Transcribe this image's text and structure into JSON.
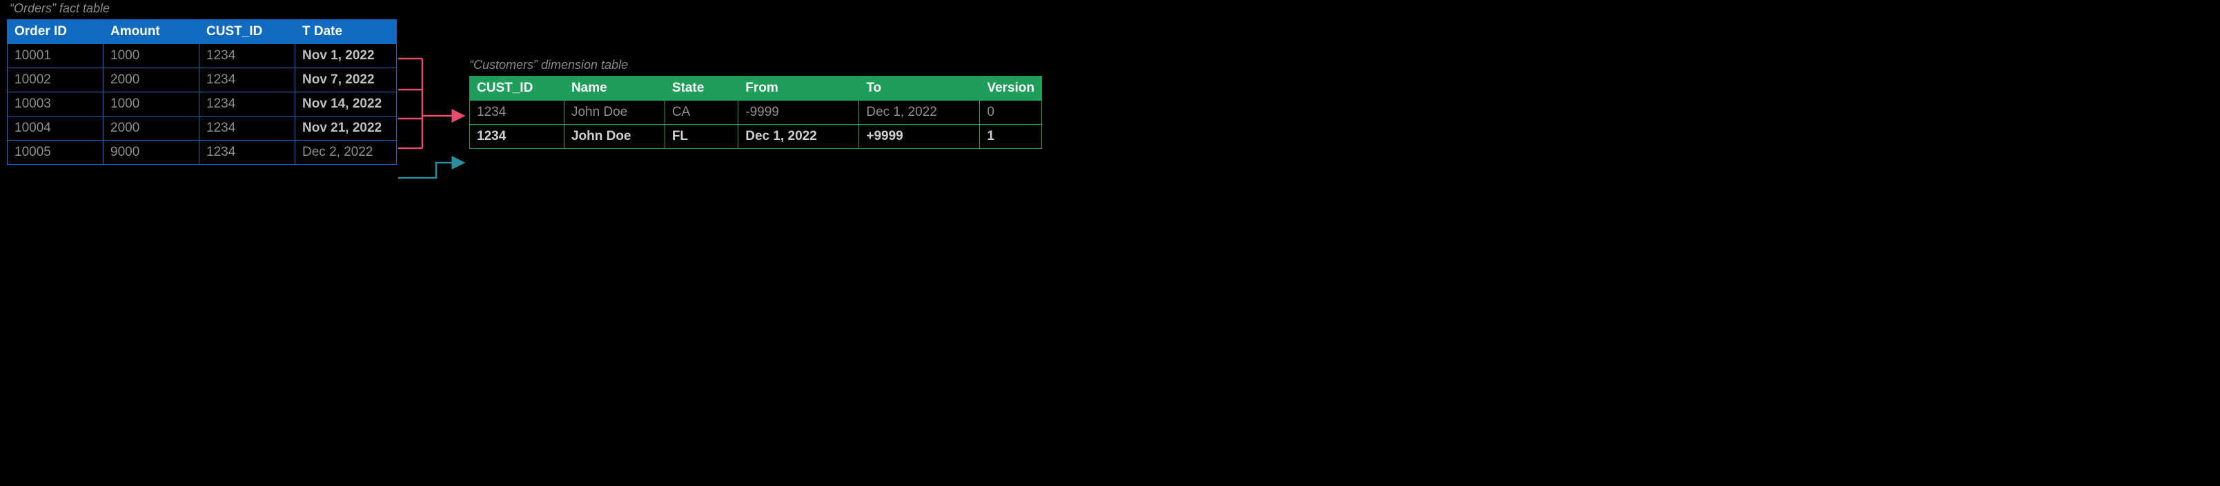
{
  "orders": {
    "caption": "“Orders” fact table",
    "headers": [
      "Order ID",
      "Amount",
      "CUST_ID",
      "T Date"
    ],
    "rows": [
      {
        "order_id": "10001",
        "amount": "1000",
        "cust_id": "1234",
        "t_date": "Nov 1, 2022",
        "date_bold": true
      },
      {
        "order_id": "10002",
        "amount": "2000",
        "cust_id": "1234",
        "t_date": "Nov 7, 2022",
        "date_bold": true
      },
      {
        "order_id": "10003",
        "amount": "1000",
        "cust_id": "1234",
        "t_date": "Nov 14, 2022",
        "date_bold": true
      },
      {
        "order_id": "10004",
        "amount": "2000",
        "cust_id": "1234",
        "t_date": "Nov 21, 2022",
        "date_bold": true
      },
      {
        "order_id": "10005",
        "amount": "9000",
        "cust_id": "1234",
        "t_date": "Dec 2, 2022",
        "date_bold": false
      }
    ]
  },
  "customers": {
    "caption": "“Customers” dimension table",
    "headers": [
      "CUST_ID",
      "Name",
      "State",
      "From",
      "To",
      "Version"
    ],
    "rows": [
      {
        "cust_id": "1234",
        "name": "John Doe",
        "state": "CA",
        "from": "-9999",
        "to": "Dec 1, 2022",
        "version": "0",
        "bold": false
      },
      {
        "cust_id": "1234",
        "name": "John Doe",
        "state": "FL",
        "from": "Dec 1, 2022",
        "to": "+9999",
        "version": "1",
        "bold": true
      }
    ]
  },
  "connectors": {
    "colors": {
      "pink": "#e54d6a",
      "teal": "#2b8ea0"
    }
  }
}
